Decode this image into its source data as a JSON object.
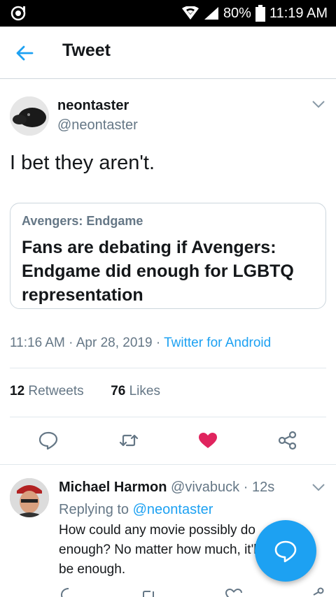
{
  "status_bar": {
    "battery": "80%",
    "time": "11:19 AM"
  },
  "header": {
    "title": "Tweet"
  },
  "tweet": {
    "display_name": "neontaster",
    "handle": "@neontaster",
    "text": "I bet they aren't.",
    "card": {
      "source": "Avengers: Endgame",
      "headline": "Fans are debating if Avengers: Endgame did enough for LGBTQ representation"
    },
    "time": "11:16 AM",
    "date": "Apr 28, 2019",
    "client": "Twitter for Android",
    "retweets_count": "12",
    "retweets_label": "Retweets",
    "likes_count": "76",
    "likes_label": "Likes"
  },
  "reply": {
    "name": "Michael Harmon",
    "handle": "@vivabuck",
    "age": "12s",
    "replying_label": "Replying to",
    "replying_to": "@neontaster",
    "text": "How could any movie possibly do enough? No matter how much, it'll never be enough."
  },
  "colors": {
    "accent": "#1da1f2",
    "like": "#e0245e",
    "secondary_text": "#657786"
  },
  "icons": [
    "back-arrow-icon",
    "chevron-down-icon",
    "reply-icon",
    "retweet-icon",
    "heart-icon",
    "share-icon",
    "compose-icon"
  ]
}
